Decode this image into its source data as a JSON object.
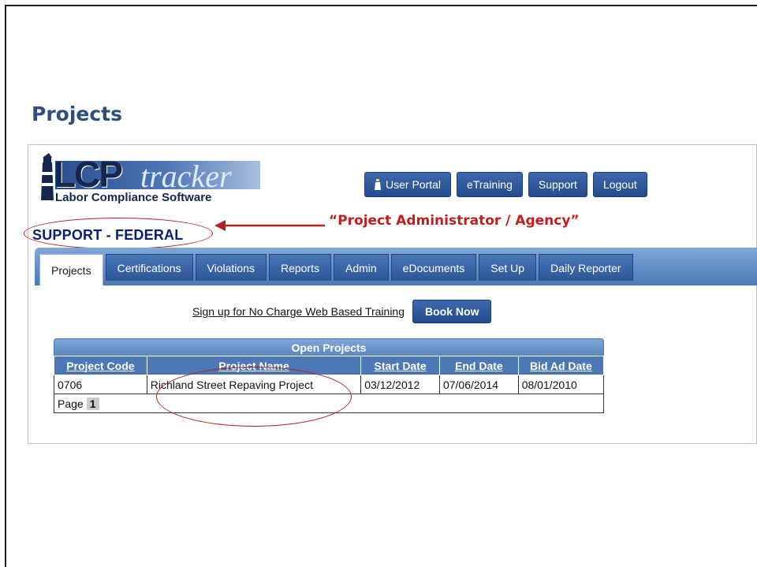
{
  "slide": {
    "title": "Projects"
  },
  "logo": {
    "brand_main": "LCP",
    "brand_accent": "tracker",
    "tagline": "Labor Compliance Software"
  },
  "agency": {
    "name": "SUPPORT - FEDERAL"
  },
  "annotation": {
    "label": "“Project Administrator / Agency”",
    "color": "#c01f1f"
  },
  "header_buttons": [
    {
      "label": "User Portal",
      "icon": "portal-icon"
    },
    {
      "label": "eTraining"
    },
    {
      "label": "Support"
    },
    {
      "label": "Logout"
    }
  ],
  "tabs": [
    {
      "label": "Projects",
      "active": true
    },
    {
      "label": "Certifications"
    },
    {
      "label": "Violations"
    },
    {
      "label": "Reports"
    },
    {
      "label": "Admin"
    },
    {
      "label": "eDocuments"
    },
    {
      "label": "Set Up"
    },
    {
      "label": "Daily Reporter"
    }
  ],
  "training": {
    "link_text": "Sign up for No Charge Web Based Training",
    "button_label": "Book Now"
  },
  "open_projects": {
    "caption": "Open Projects",
    "columns": [
      "Project Code",
      "Project Name",
      "Start Date",
      "End Date",
      "Bid Ad Date"
    ],
    "rows": [
      [
        "0706",
        "Richland Street Repaving Project",
        "03/12/2012",
        "07/06/2014",
        "08/01/2010"
      ]
    ],
    "pager": {
      "label": "Page",
      "current": "1"
    }
  },
  "colors": {
    "brand_blue": "#244b8d",
    "title_blue": "#2e4f7d",
    "annotation_red": "#b22222"
  }
}
